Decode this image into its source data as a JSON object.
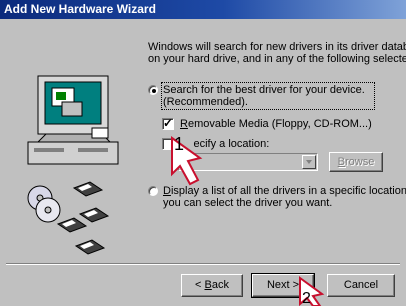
{
  "window": {
    "title": "Add New Hardware Wizard"
  },
  "intro": {
    "line1": "Windows will search for new drivers in its driver database",
    "line2": "on your hard drive, and in any of the following selected"
  },
  "options": {
    "search_best": {
      "line1": "Search for the best driver for your device.",
      "line2": "(Recommended).",
      "selected": true
    },
    "removable_media": {
      "label": "emovable Media (Floppy, CD-ROM...)",
      "accel": "R",
      "checked": true
    },
    "specify_location": {
      "label": "ecify a location:",
      "prefix": "Sp",
      "checked": false
    },
    "location_path": "",
    "display_list": {
      "accel": "D",
      "line1": "isplay a list of all the drivers in a specific location, so",
      "line2": "you can select the driver you want.",
      "selected": false
    }
  },
  "buttons": {
    "browse": "rowse",
    "browse_accel": "B",
    "back": "ack",
    "back_prefix": "< ",
    "back_accel": "B",
    "next": "Next >",
    "cancel": "Cancel"
  },
  "annotations": {
    "step1": "1",
    "step2": "2"
  },
  "colors": {
    "title_bar": "#0b2a7c",
    "face": "#c0c0c0",
    "callout": "#c8102e"
  }
}
